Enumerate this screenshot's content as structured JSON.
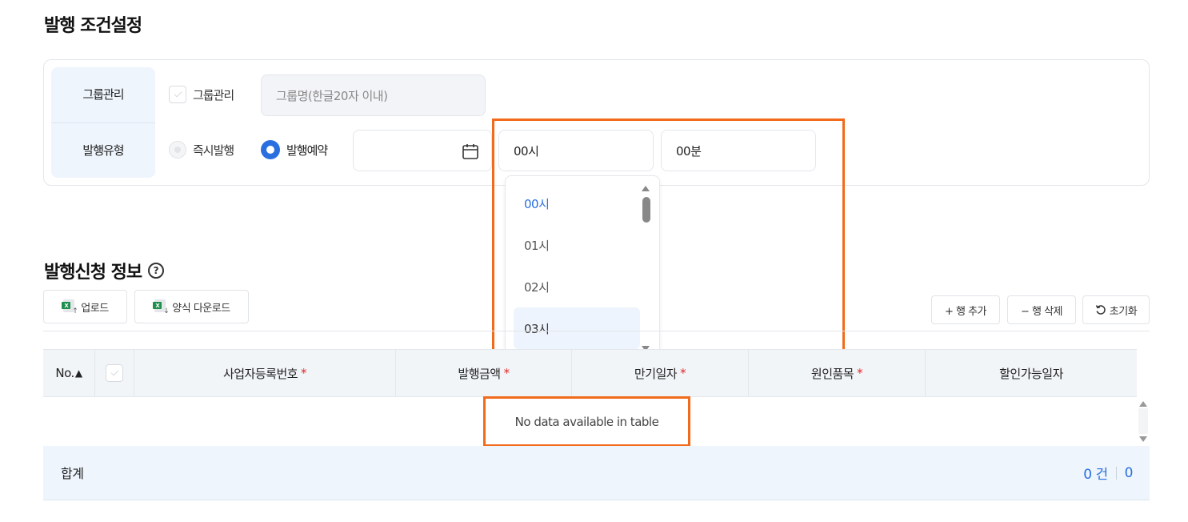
{
  "conditions": {
    "title": "발행 조건설정",
    "group_row": {
      "label": "그룹관리",
      "checkbox_label": "그룹관리",
      "group_name_placeholder": "그룹명(한글20자 이내)"
    },
    "type_row": {
      "label": "발행유형",
      "option_immediate": "즉시발행",
      "option_reserved": "발행예약",
      "hour_value": "00시",
      "minute_value": "00분"
    },
    "hour_dropdown": {
      "options": [
        "00시",
        "01시",
        "02시",
        "03시"
      ],
      "selected": "00시",
      "hovered": "03시"
    }
  },
  "application": {
    "title": "발행신청 정보",
    "help_icon": "?",
    "upload_label": "업로드",
    "template_download_label": "양식 다운로드",
    "add_row_label": "+ 행 추가",
    "delete_row_label": "− 행 삭제",
    "reset_label": "초기화",
    "columns": {
      "no": "No.",
      "sort_indicator": "▲",
      "business_number": "사업자등록번호",
      "amount": "발행금액",
      "due_date": "만기일자",
      "cause_item": "원인품목",
      "discountable_date": "할인가능일자",
      "required_mark": "*"
    },
    "empty_message": "No data available in table",
    "summary": {
      "label": "합계",
      "count": "0 건",
      "total": "0"
    }
  },
  "colors": {
    "accent": "#2a6fe0",
    "highlight": "#f26a1b",
    "required": "#e02828",
    "label_bg": "#eef5fd"
  },
  "icons": [
    "calendar-icon",
    "help-icon",
    "excel-upload-icon",
    "excel-download-icon",
    "reset-icon",
    "checkbox-icon",
    "sort-up-icon"
  ]
}
